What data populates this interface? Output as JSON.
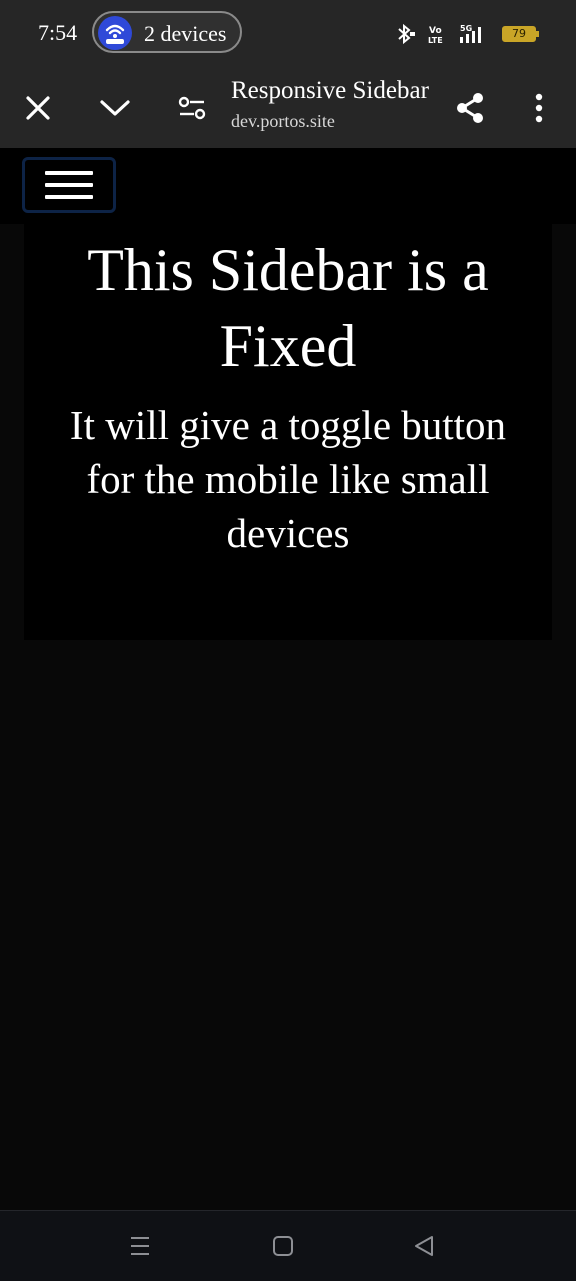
{
  "status_bar": {
    "time": "7:54",
    "hotspot_label": "2 devices",
    "icons": [
      "bluetooth-icon",
      "volte-icon",
      "5g-signal-icon"
    ],
    "battery_level": "79",
    "battery_color": "#c9a527",
    "hotspot_color": "#2f49d8"
  },
  "toolbar": {
    "title": "Responsive Sidebar",
    "url": "dev.portos.site",
    "buttons": [
      "close-icon",
      "chevron-down-icon",
      "page-settings-icon",
      "share-icon",
      "more-vert-icon"
    ]
  },
  "page": {
    "menu_icon": "hamburger-menu-icon",
    "heading": "This Sidebar is a Fixed",
    "subheading": "It will give a toggle button for the mobile like small devices"
  },
  "system_nav": {
    "buttons": [
      "recents-icon",
      "home-icon",
      "back-icon"
    ]
  }
}
